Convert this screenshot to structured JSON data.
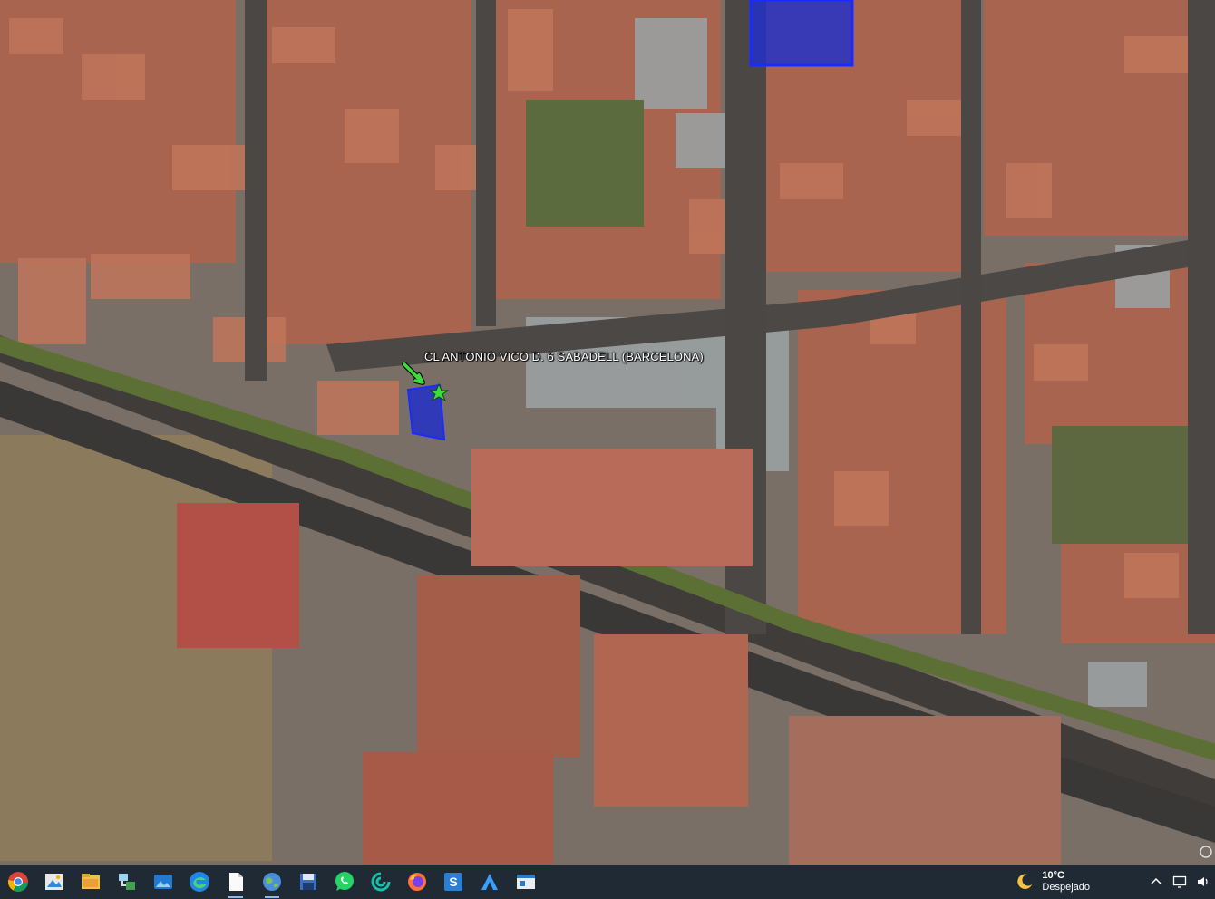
{
  "map": {
    "parcel_label": "CL ANTONIO VICO D. 6  SABADELL (BARCELONA)",
    "colors": {
      "parcel_fill": "#2331c8",
      "parcel_outline": "#1a2bff",
      "marker_arrow": "#3ddc3d",
      "marker_star": "#3ddc3d"
    }
  },
  "taskbar": {
    "apps": [
      {
        "name": "chrome-icon"
      },
      {
        "name": "image-viewer-icon"
      },
      {
        "name": "file-explorer-icon"
      },
      {
        "name": "network-share-icon"
      },
      {
        "name": "photos-icon"
      },
      {
        "name": "edge-icon"
      },
      {
        "name": "document-icon"
      },
      {
        "name": "google-earth-icon"
      },
      {
        "name": "save-disk-icon"
      },
      {
        "name": "whatsapp-icon"
      },
      {
        "name": "app-swirl-icon"
      },
      {
        "name": "firefox-icon"
      },
      {
        "name": "app-s-icon"
      },
      {
        "name": "app-a-icon"
      },
      {
        "name": "window-app-icon"
      }
    ],
    "weather": {
      "temperature": "10°C",
      "condition": "Despejado",
      "icon": "moon-icon"
    },
    "tray": [
      "chevron-up-icon",
      "monitor-icon",
      "volume-icon"
    ]
  }
}
